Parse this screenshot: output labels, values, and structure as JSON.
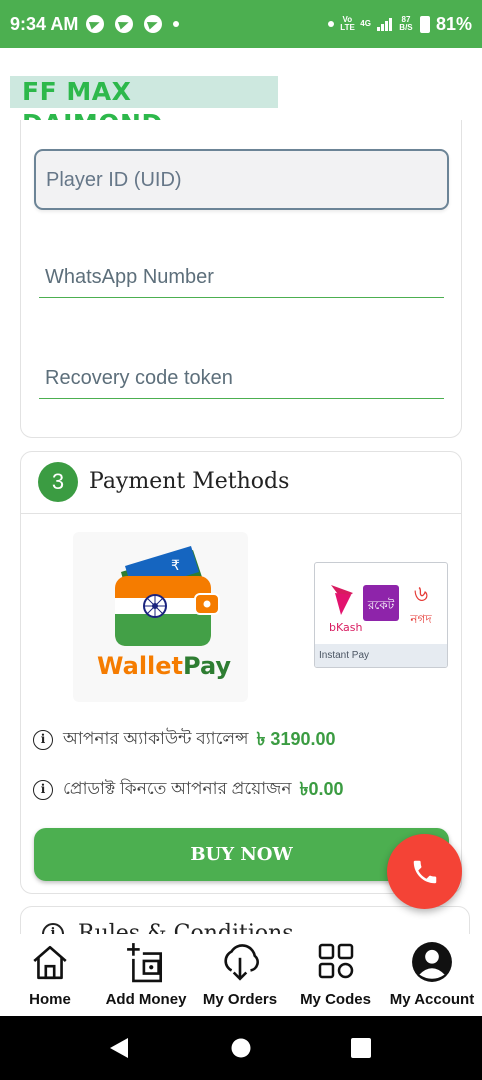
{
  "status_bar": {
    "time": "9:34 AM",
    "network": "Vo LTE",
    "network_type": "4G",
    "speed_value": "87",
    "speed_unit": "B/S",
    "battery": "81%"
  },
  "brand": {
    "title": "FF MAX DAIMOND"
  },
  "form": {
    "uid_placeholder": "Player ID (UID)",
    "whatsapp_placeholder": "WhatsApp Number",
    "recovery_placeholder": "Recovery code token"
  },
  "payment": {
    "step": "3",
    "title": "Payment Methods",
    "wallet_name": "WalletPay",
    "wallet_name_part1": "Wallet",
    "wallet_name_part2": "Pay",
    "instant_label": "Instant Pay",
    "instant_brands": {
      "bkash": "bKash",
      "rocket": "রকেট",
      "nagad": "নগদ"
    },
    "balance_label": "আপনার অ্যাকাউন্ট ব্যালেন্স",
    "balance_value": "৳ 3190.00",
    "required_label": "প্রোডাক্ট কিনতে আপনার প্রয়োজন",
    "required_value": "৳0.00",
    "buy_label": "BUY NOW"
  },
  "rules": {
    "title": "Rules & Conditions"
  },
  "bottom_nav": [
    {
      "label": "Home",
      "icon": "home-icon"
    },
    {
      "label": "Add Money",
      "icon": "add-money-icon"
    },
    {
      "label": "My Orders",
      "icon": "download-icon"
    },
    {
      "label": "My Codes",
      "icon": "grid-icon"
    },
    {
      "label": "My Account",
      "icon": "account-icon"
    }
  ],
  "colors": {
    "accent": "#4caf50",
    "step_green": "#3b9c42",
    "fab_red": "#f44336",
    "brand_bg": "#cde8df"
  }
}
